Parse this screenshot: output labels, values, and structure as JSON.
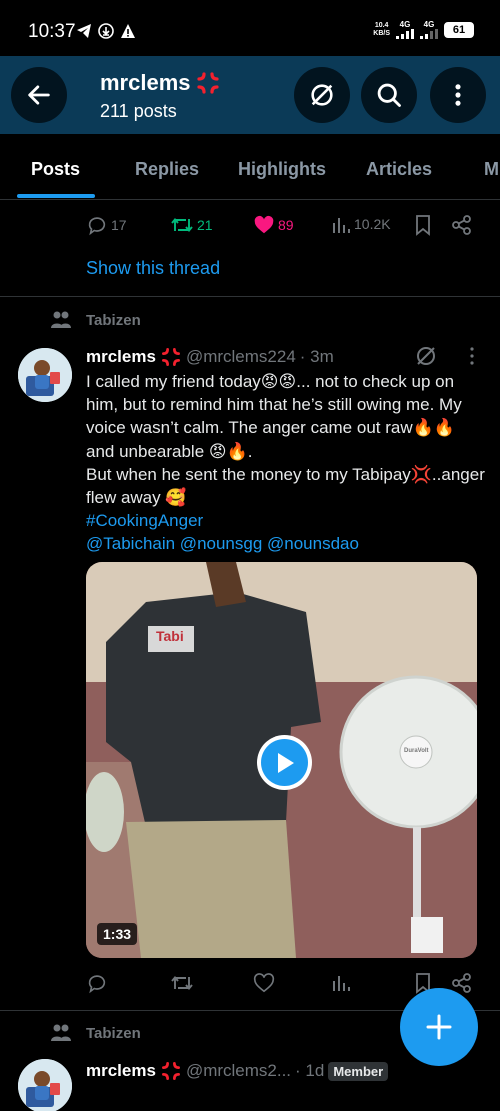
{
  "status_bar": {
    "time": "10:37",
    "speed_top": "10.4",
    "speed_bottom": "KB/S",
    "network_1": "4G",
    "network_2": "4G",
    "battery": "61"
  },
  "header": {
    "title": "mrclems",
    "post_count": "211 posts"
  },
  "tabs": [
    {
      "label": "Posts"
    },
    {
      "label": "Replies"
    },
    {
      "label": "Highlights"
    },
    {
      "label": "Articles"
    },
    {
      "label": "M"
    }
  ],
  "prev_post": {
    "replies": "17",
    "reposts": "21",
    "likes": "89",
    "views": "10.2K",
    "show_thread": "Show this thread"
  },
  "post1": {
    "reposted_by": "Tabizen",
    "name": "mrclems",
    "handle": "@mrclems224",
    "time": "· 3m",
    "lines": [
      "I called my friend today😡😡... not to check up on him,  but to remind him that he’s still owing me. My voice wasn’t calm. The anger came out raw🔥🔥 and unbearable 😡🔥.",
      "But when he sent the money to my Tabipay💢..anger flew away 🥰"
    ],
    "hashtag": "#CookingAnger",
    "mentions": "@Tabichain @nounsgg  @nounsdao",
    "media_shirt_text": "Tabi",
    "media_fan_brand": "DuraVolt",
    "video_duration": "1:33"
  },
  "post2": {
    "reposted_by": "Tabizen",
    "name": "mrclems",
    "handle": "@mrclems2...",
    "time": "· 1d",
    "badge": "Member"
  },
  "colors": {
    "accent": "#1d9bf0",
    "header_bg": "#0b3a57",
    "like": "#f91880",
    "repost": "#00ba7c"
  }
}
